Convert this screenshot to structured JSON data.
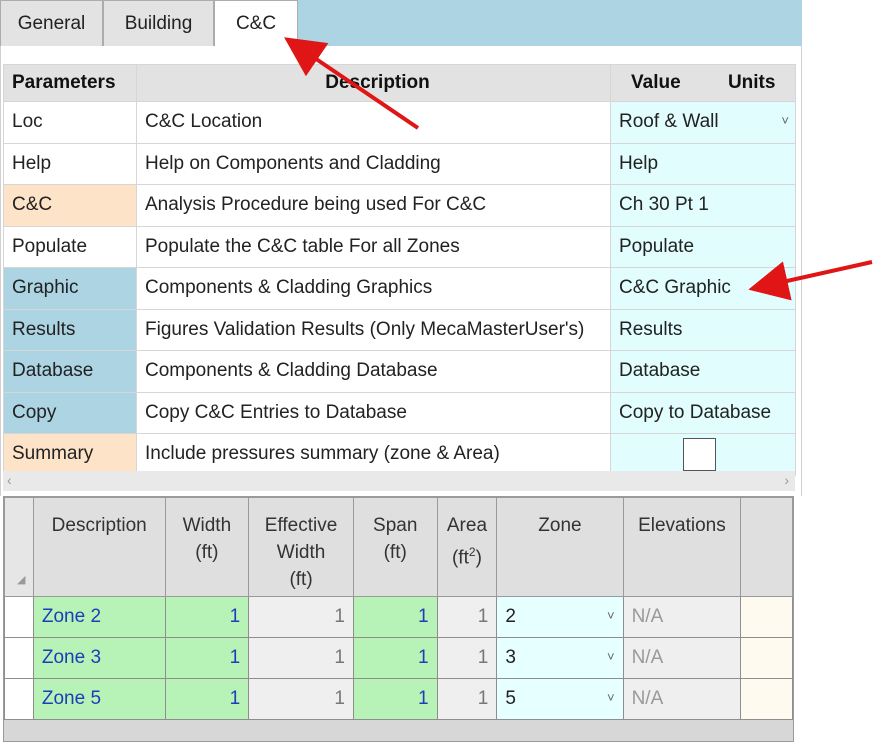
{
  "tabs": [
    {
      "label": "General",
      "active": false
    },
    {
      "label": "Building",
      "active": false
    },
    {
      "label": "C&C",
      "active": true
    }
  ],
  "params": {
    "headers": {
      "parameters": "Parameters",
      "description": "Description",
      "value": "Value",
      "units": "Units"
    },
    "rows": [
      {
        "param": "Loc",
        "desc": "C&C Location",
        "value": "Roof & Wall",
        "dropdown": true,
        "checkbox": false
      },
      {
        "param": "Help",
        "desc": "Help on Components and Cladding",
        "value": "Help",
        "dropdown": false,
        "checkbox": false
      },
      {
        "param": "C&C",
        "desc": "Analysis Procedure being used For C&C",
        "value": "Ch 30 Pt 1",
        "dropdown": false,
        "checkbox": false
      },
      {
        "param": "Populate",
        "desc": "Populate the C&C table For all Zones",
        "value": "Populate",
        "dropdown": false,
        "checkbox": false
      },
      {
        "param": "Graphic",
        "desc": "Components & Cladding Graphics",
        "value": "C&C Graphic",
        "dropdown": false,
        "checkbox": false
      },
      {
        "param": "Results",
        "desc": "Figures Validation Results (Only MecaMasterUser's)",
        "value": "Results",
        "dropdown": false,
        "checkbox": false
      },
      {
        "param": "Database",
        "desc": "Components & Cladding Database",
        "value": "Database",
        "dropdown": false,
        "checkbox": false
      },
      {
        "param": "Copy",
        "desc": "Copy C&C Entries to Database",
        "value": "Copy to Database",
        "dropdown": false,
        "checkbox": false
      },
      {
        "param": "Summary",
        "desc": "Include pressures summary (zone & Area)",
        "value": "",
        "dropdown": false,
        "checkbox": true
      }
    ]
  },
  "zones": {
    "headers": {
      "description": "Description",
      "width": [
        "Width",
        "(ft)"
      ],
      "effective_width": [
        "Effective",
        "Width",
        "(ft)"
      ],
      "span": [
        "Span",
        "(ft)"
      ],
      "area": [
        "Area",
        "(ft",
        "2",
        ")"
      ],
      "zone": "Zone",
      "elevations": "Elevations"
    },
    "rows": [
      {
        "desc": "Zone 2",
        "width": "1",
        "eff_width": "1",
        "span": "1",
        "area": "1",
        "zone": "2",
        "elev": "N/A"
      },
      {
        "desc": "Zone 3",
        "width": "1",
        "eff_width": "1",
        "span": "1",
        "area": "1",
        "zone": "3",
        "elev": "N/A"
      },
      {
        "desc": "Zone 5",
        "width": "1",
        "eff_width": "1",
        "span": "1",
        "area": "1",
        "zone": "5",
        "elev": "N/A"
      }
    ]
  },
  "colors": {
    "tab_bar": "#acd4e3",
    "orange_param": "#fde3c8",
    "blue_param": "#acd4e3",
    "value_cell": "#e1fdfd",
    "green_cell": "#b7f3b7",
    "arrow": "#e01515"
  },
  "icons": {
    "dropdown": "chevron-down-icon",
    "scroll_left": "chevron-left-icon",
    "scroll_right": "chevron-right-icon",
    "resize": "resize-grip-icon"
  }
}
